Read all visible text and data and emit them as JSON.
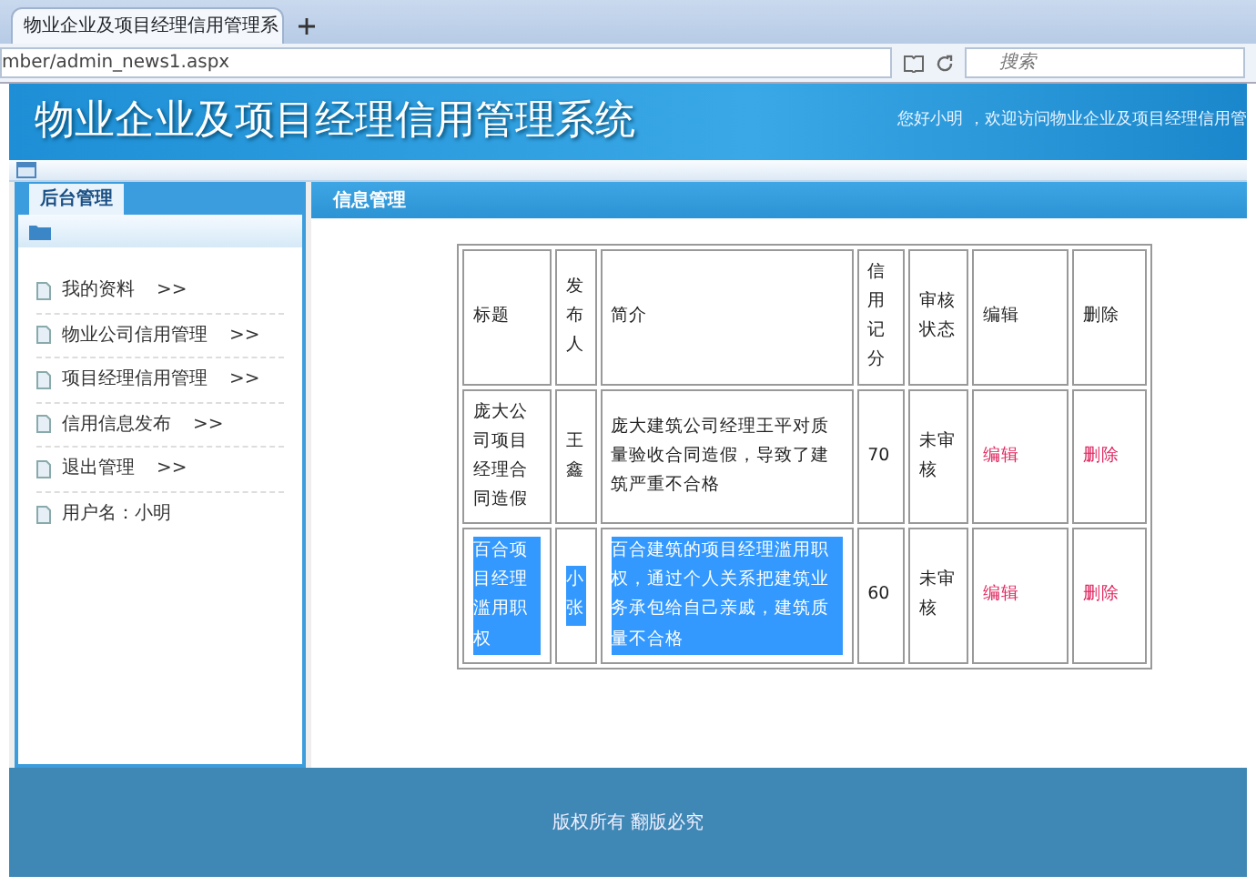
{
  "browser": {
    "tab_title": "物业企业及项目经理信用管理系",
    "address": "mber/admin_news1.aspx",
    "search": {
      "placeholder": "搜索"
    }
  },
  "header": {
    "title": "物业企业及项目经理信用管理系统",
    "welcome": "您好小明 ，欢迎访问物业企业及项目经理信用管"
  },
  "sidebar": {
    "title": "后台管理",
    "items": [
      {
        "label": "我的资料",
        "arrow": ">>"
      },
      {
        "label": "物业公司信用管理",
        "arrow": ">>"
      },
      {
        "label": "项目经理信用管理",
        "arrow": ">>"
      },
      {
        "label": "信用信息发布",
        "arrow": ">>"
      },
      {
        "label": "退出管理",
        "arrow": ">>"
      },
      {
        "label": "用户名：小明"
      }
    ]
  },
  "main": {
    "title": "信息管理",
    "table": {
      "columns": [
        "标题",
        "发布人",
        "简介",
        "信用记分",
        "审核状态",
        "编辑",
        "删除"
      ],
      "rows": [
        {
          "title": "庞大公司项目经理合同造假",
          "publisher": "王鑫",
          "summary": "庞大建筑公司经理王平对质量验收合同造假，导致了建筑严重不合格",
          "score": "70",
          "status": "未审核",
          "edit": "编辑",
          "delete": "删除",
          "text_selected": false
        },
        {
          "title": "百合项目经理滥用职权",
          "publisher": "小张",
          "summary": "百合建筑的项目经理滥用职权，通过个人关系把建筑业务承包给自己亲戚，建筑质量不合格",
          "score": "60",
          "status": "未审核",
          "edit": "编辑",
          "delete": "删除",
          "text_selected": true
        }
      ]
    }
  },
  "footer": {
    "text": "版权所有 翻版必究"
  }
}
